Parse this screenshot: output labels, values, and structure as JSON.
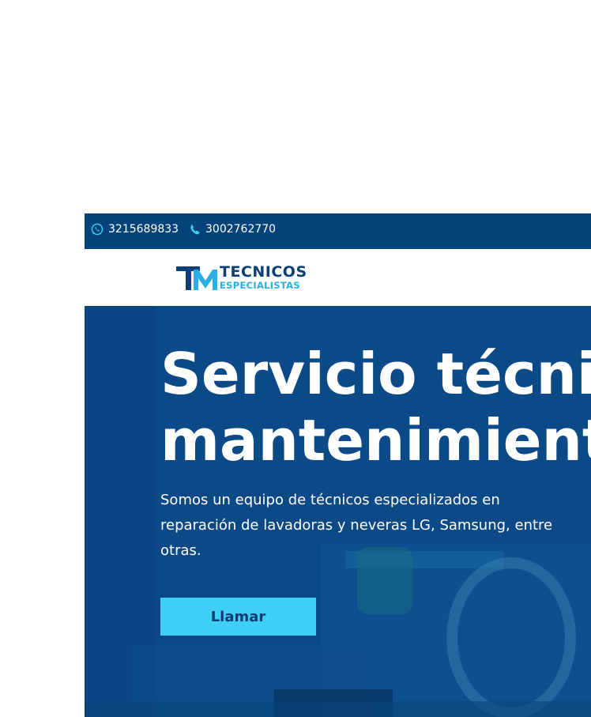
{
  "topbar": {
    "whatsapp_number": "3215689833",
    "phone_number": "3002762770",
    "icons": {
      "whatsapp": "whatsapp-icon",
      "phone": "phone-icon"
    }
  },
  "header": {
    "logo": {
      "line1": "TECNICOS",
      "line2": "ESPECIALISTAS"
    }
  },
  "hero": {
    "title_line1": "Servicio técni",
    "title_line2": "mantenimient",
    "description": "Somos un equipo de técnicos especializados en reparación de lavadoras y neveras LG, Samsung, entre otras.",
    "cta_label": "Llamar"
  },
  "colors": {
    "topbar_bg": "#03437a",
    "hero_overlay": "#0a4a86",
    "accent_cyan": "#3fd0f7",
    "logo_dark": "#0a3f77",
    "logo_light": "#29aee6"
  }
}
